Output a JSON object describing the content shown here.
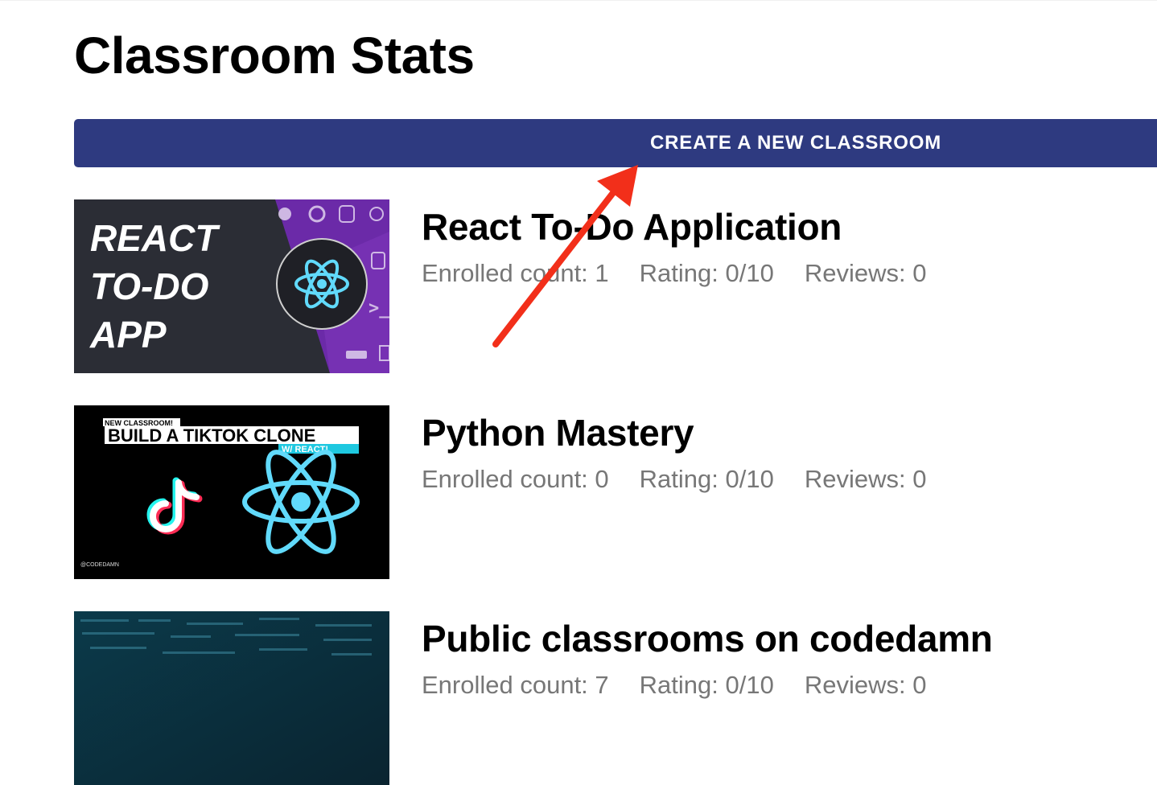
{
  "page": {
    "title": "Classroom Stats"
  },
  "toolbar": {
    "create_label": "CREATE A NEW CLASSROOM"
  },
  "classrooms": [
    {
      "title": "React To-Do Application",
      "enrolled": "Enrolled count: 1",
      "rating": "Rating: 0/10",
      "reviews": "Reviews: 0",
      "thumb": {
        "lines": [
          "REACT",
          "TO-DO",
          "APP"
        ]
      }
    },
    {
      "title": "Python Mastery",
      "enrolled": "Enrolled count: 0",
      "rating": "Rating: 0/10",
      "reviews": "Reviews: 0",
      "thumb": {
        "badge": "NEW CLASSROOM!",
        "headline": "BUILD A TIKTOK CLONE",
        "sub": "W/ REACT!",
        "credit": "@CODEDAMN"
      }
    },
    {
      "title": "Public classrooms on codedamn",
      "enrolled": "Enrolled count: 7",
      "rating": "Rating: 0/10",
      "reviews": "Reviews: 0"
    }
  ],
  "colors": {
    "primary": "#2e3a80",
    "muted_text": "#777777",
    "annotation_arrow": "#f22f1a",
    "react_blue": "#61dafb"
  },
  "icons": [
    "react-logo-icon",
    "tiktok-logo-icon",
    "annotation-arrow"
  ]
}
